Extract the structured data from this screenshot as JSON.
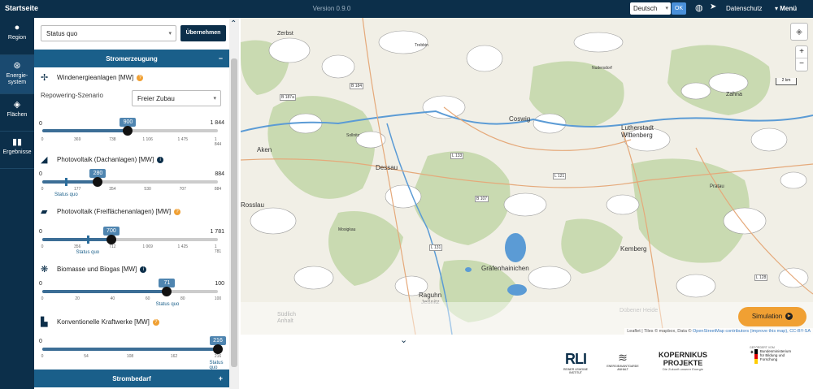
{
  "topbar": {
    "home": "Startseite",
    "version": "Version 0.9.0",
    "language": "Deutsch",
    "ok": "OK",
    "privacy": "Datenschutz",
    "menu": "Menü"
  },
  "nav": [
    {
      "label": "Region",
      "icon": "map-pin-icon"
    },
    {
      "label": "Energie-system",
      "icon": "energy-system-icon"
    },
    {
      "label": "Flächen",
      "icon": "layers-icon"
    },
    {
      "label": "Ergebnisse",
      "icon": "bar-chart-icon"
    }
  ],
  "panel": {
    "scenario": "Status quo",
    "apply": "Übernehmen",
    "section_power": "Stromerzeugung",
    "section_power_sign": "−",
    "section_demand": "Strombedarf",
    "section_demand_sign": "+",
    "wind": {
      "title": "Windenergieanlagen [MW]",
      "repowering_label": "Repowering-Szenario",
      "repowering_value": "Freier Zubau",
      "min": "0",
      "max": "1 844",
      "value": "900",
      "value_num": 900,
      "max_num": 1844,
      "ticks": [
        "0",
        "369",
        "738",
        "1 106",
        "1 475",
        "1 844"
      ]
    },
    "pv_roof": {
      "title": "Photovoltaik (Dachanlagen) [MW]",
      "min": "0",
      "max": "884",
      "value": "280",
      "value_num": 280,
      "max_num": 884,
      "status_quo_num": 120,
      "status_quo_label": "Status quo",
      "ticks": [
        "0",
        "177",
        "354",
        "530",
        "707",
        "884"
      ]
    },
    "pv_ground": {
      "title": "Photovoltaik (Freiflächenanlagen) [MW]",
      "min": "0",
      "max": "1 781",
      "value": "700",
      "value_num": 700,
      "max_num": 1781,
      "status_quo_num": 460,
      "status_quo_label": "Status quo",
      "ticks": [
        "0",
        "356",
        "712",
        "1 069",
        "1 425",
        "1 781"
      ]
    },
    "biomass": {
      "title": "Biomasse und Biogas [MW]",
      "min": "0",
      "max": "100",
      "value": "71",
      "value_num": 71,
      "max_num": 100,
      "status_quo_label": "Status quo",
      "ticks": [
        "0",
        "20",
        "40",
        "60",
        "80",
        "100"
      ]
    },
    "conventional": {
      "title": "Konventionelle Kraftwerke [MW]",
      "min": "0",
      "value": "216",
      "value_num": 216,
      "max_num": 216,
      "status_quo_label": "Status quo",
      "ticks": [
        "0",
        "54",
        "108",
        "162",
        "216"
      ]
    }
  },
  "map": {
    "places": [
      "Zerbst",
      "Trebbin",
      "Nudersdorf",
      "Coswig",
      "Lutherstadt Wittenberg",
      "Aken",
      "Dessau",
      "Sollnitz",
      "Kemberg",
      "Gräfenhainichen",
      "Raguhn",
      "Jeßnitz",
      "Südlich Anhalt",
      "Zahna",
      "Elster",
      "Oranienbaum",
      "Pratau",
      "Dübener Heide",
      "Mosigkau",
      "Schönfeld",
      "Rosslau"
    ],
    "roads": [
      "B 184",
      "B 187a",
      "L 133",
      "B 107",
      "L 131",
      "L 128",
      "L 121",
      "B 185"
    ],
    "scale": "2 km",
    "attribution_plain": "Leaflet | Tiles © mapbox, Data © ",
    "attribution_link": "OpenStreetMap contributors (improve this map), CC-BY-SA",
    "simulation": "Simulation",
    "zoom_in": "+",
    "zoom_out": "−"
  },
  "logos": {
    "rli_big": "RLI",
    "rli_small": "REINER LEMOINE INSTITUT",
    "eaa_small": "ENERGIEAVANTGARDE ANHALT",
    "kop_line1": "KOPERNIKUS",
    "kop_line2": "PROJEKTE",
    "kop_line3": "Die Zukunft unserer Energie",
    "bmbf_top": "GEFÖRDERT VOM",
    "bmbf_text": "Bundesministerium für Bildung und Forschung"
  },
  "colors": {
    "navy": "#0c2f4a",
    "accent_blue": "#1a5f8a",
    "simulation_orange": "#f0a033",
    "forest": "#c9dab1",
    "water": "#5b9bd5"
  }
}
